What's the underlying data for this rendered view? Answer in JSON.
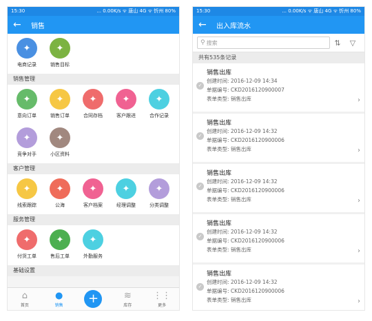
{
  "left": {
    "status": {
      "time": "15:30",
      "right": "... 0.00K/s ᯤ 唐山 4G ᯤ 忻州 80%"
    },
    "title": "销售",
    "top_items": [
      {
        "label": "电商记录",
        "color": "#4a90e2",
        "icon": "cart-icon"
      },
      {
        "label": "销售目标",
        "color": "#7cb342",
        "icon": "target-icon"
      }
    ],
    "sections": [
      {
        "header": "销售管理",
        "items": [
          {
            "label": "意向订单",
            "color": "#66bb6a",
            "icon": "order-icon"
          },
          {
            "label": "销售订单",
            "color": "#f6c744",
            "icon": "crown-icon"
          },
          {
            "label": "合同存档",
            "color": "#ef6c6c",
            "icon": "archive-icon"
          },
          {
            "label": "客户跟进",
            "color": "#f06292",
            "icon": "person-icon"
          },
          {
            "label": "合作记录",
            "color": "#4dd0e1",
            "icon": "handshake-icon"
          },
          {
            "label": "竞争对手",
            "color": "#b39ddb",
            "icon": "rival-icon"
          },
          {
            "label": "小区资料",
            "color": "#a1887f",
            "icon": "community-icon"
          }
        ]
      },
      {
        "header": "客户管理",
        "items": [
          {
            "label": "线索跟踪",
            "color": "#f6c744",
            "icon": "clue-icon"
          },
          {
            "label": "公海",
            "color": "#ef6c5a",
            "icon": "sea-icon"
          },
          {
            "label": "客户档案",
            "color": "#f06292",
            "icon": "file-icon"
          },
          {
            "label": "经理调整",
            "color": "#4dd0e1",
            "icon": "manager-icon"
          },
          {
            "label": "分类调整",
            "color": "#b39ddb",
            "icon": "category-icon"
          }
        ]
      },
      {
        "header": "服务管理",
        "items": [
          {
            "label": "付货工单",
            "color": "#ef6c6c",
            "icon": "delivery-icon"
          },
          {
            "label": "售后工单",
            "color": "#4caf50",
            "icon": "service-icon"
          },
          {
            "label": "外勤服务",
            "color": "#4dd0e1",
            "icon": "field-icon"
          }
        ]
      },
      {
        "header": "基础设置",
        "items": []
      }
    ],
    "tabbar": [
      {
        "label": "首页",
        "icon": "home-icon",
        "glyph": "⌂",
        "active": false
      },
      {
        "label": "销售",
        "icon": "sales-person-icon",
        "glyph": "●",
        "active": true
      },
      {
        "label": "",
        "icon": "plus-icon",
        "glyph": "+",
        "fab": true
      },
      {
        "label": "库存",
        "icon": "stock-icon",
        "glyph": "≋",
        "active": false
      },
      {
        "label": "更多",
        "icon": "more-icon",
        "glyph": "⋮⋮",
        "active": false
      }
    ]
  },
  "right": {
    "status": {
      "time": "15:30",
      "right": "... 0.00K/s ᯤ 唐山 4G ᯤ 忻州 80%"
    },
    "title": "出入库流水",
    "search_placeholder": "搜索",
    "count_text": "共有535条记录",
    "cards": [
      {
        "title": "销售出库",
        "created": "创建时间: 2016-12-09 14:34",
        "number": "单据编号: CKD2016120900007",
        "type": "表单类型: 销售出库"
      },
      {
        "title": "销售出库",
        "created": "创建时间: 2016-12-09 14:32",
        "number": "单据编号: CKD2016120900006",
        "type": "表单类型: 销售出库"
      },
      {
        "title": "销售出库",
        "created": "创建时间: 2016-12-09 14:32",
        "number": "单据编号: CKD2016120900006",
        "type": "表单类型: 销售出库"
      },
      {
        "title": "销售出库",
        "created": "创建时间: 2016-12-09 14:32",
        "number": "单据编号: CKD2016120900006",
        "type": "表单类型: 销售出库"
      },
      {
        "title": "销售出库",
        "created": "创建时间: 2016-12-09 14:32",
        "number": "单据编号: CKD2016120900006",
        "type": "表单类型: 销售出库"
      }
    ]
  }
}
